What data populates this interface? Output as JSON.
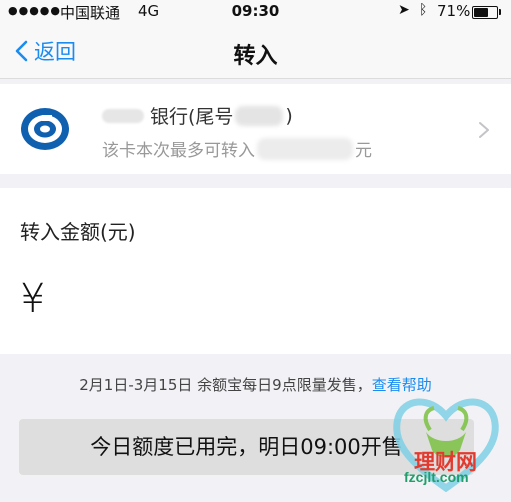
{
  "status_bar": {
    "signal_dots": "●●●●●",
    "carrier": "中国联通",
    "network": "4G",
    "time": "09:30",
    "battery_percent": "71%",
    "battery_level": 0.71,
    "icons": [
      "location-arrow-icon",
      "bluetooth-icon",
      "battery-icon"
    ]
  },
  "nav": {
    "back_label": "返回",
    "title": "转入"
  },
  "bank_card": {
    "name": "银行(尾号",
    "name_close": ")",
    "limit_prefix": "该卡本次最多可转入",
    "limit_suffix": "元"
  },
  "amount": {
    "label": "转入金额(元)",
    "currency_symbol": "¥",
    "value": ""
  },
  "notice": {
    "text": "2月1日-3月15日 余额宝每日9点限量发售，",
    "link": "查看帮助"
  },
  "action": {
    "label": "今日额度已用完，明日09:00开售"
  },
  "watermark": {
    "text": "理财网",
    "url": "fzcjlt.com"
  },
  "colors": {
    "accent": "#1a8cf0",
    "bank_logo": "#1060b0",
    "button_disabled": "#dedede",
    "background": "#f2f2f6"
  }
}
